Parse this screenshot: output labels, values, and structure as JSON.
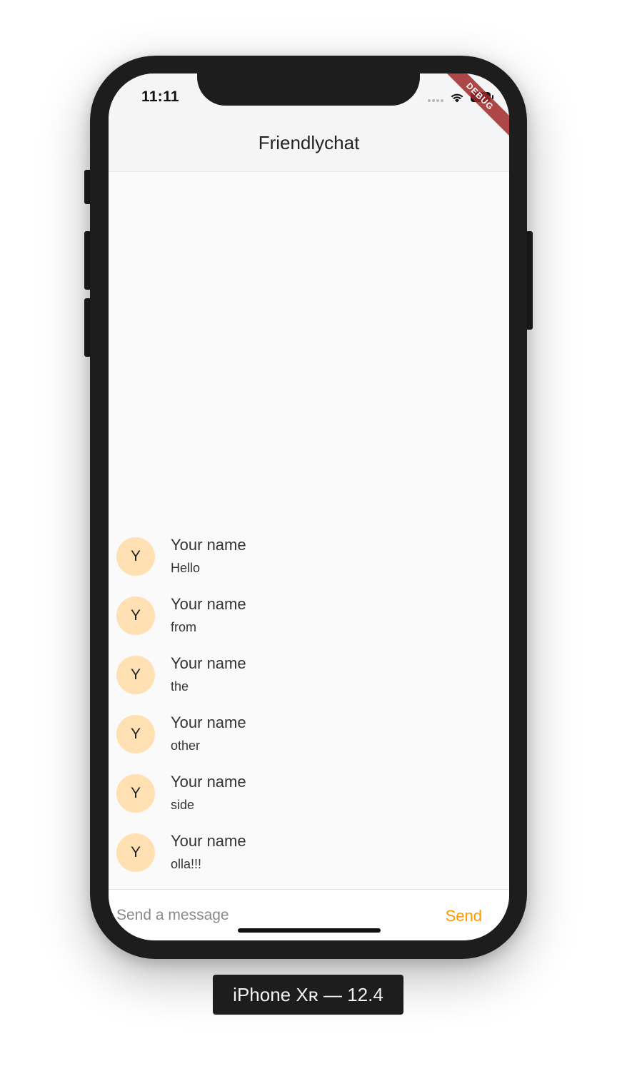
{
  "status_bar": {
    "time": "11:11"
  },
  "app": {
    "title": "Friendlychat",
    "debug_banner": "DEBUG"
  },
  "messages": [
    {
      "avatar": "Y",
      "name": "Your name",
      "text": "Hello"
    },
    {
      "avatar": "Y",
      "name": "Your name",
      "text": "from"
    },
    {
      "avatar": "Y",
      "name": "Your name",
      "text": "the"
    },
    {
      "avatar": "Y",
      "name": "Your name",
      "text": "other"
    },
    {
      "avatar": "Y",
      "name": "Your name",
      "text": "side"
    },
    {
      "avatar": "Y",
      "name": "Your name",
      "text": "olla!!!"
    }
  ],
  "composer": {
    "placeholder": "Send a message",
    "value": "",
    "send_label": "Send"
  },
  "device_label": "iPhone Xʀ — 12.4",
  "colors": {
    "accent": "#ff9800",
    "avatar_bg": "#ffe0b2",
    "appbar_bg": "#f5f5f5",
    "screen_bg": "#fafafa"
  }
}
